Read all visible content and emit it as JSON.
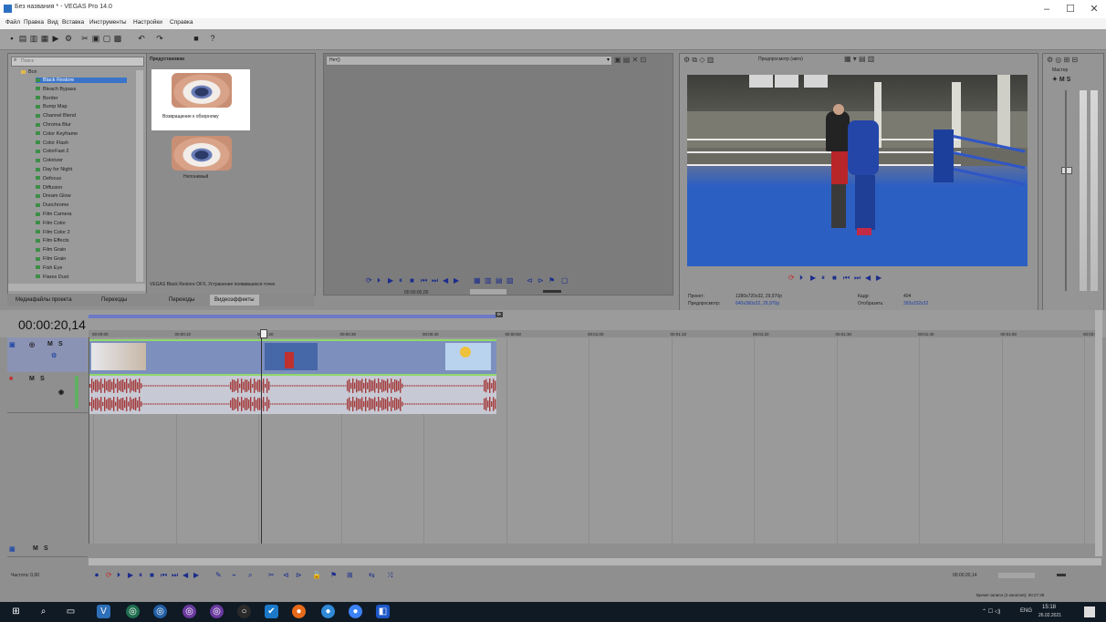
{
  "window": {
    "title": "Без названия * - VEGAS Pro 14.0",
    "controls": [
      "–",
      "☐",
      "✕"
    ]
  },
  "menu": [
    "Файл",
    "Правка",
    "Вид",
    "Вставка",
    "Инструменты",
    "Настройки",
    "Справка"
  ],
  "toolbar_icons": [
    "new-icon",
    "open-icon",
    "save-icon",
    "render-icon",
    "properties-icon",
    "cut-icon",
    "copy-icon",
    "paste-icon",
    "undo-icon",
    "redo-icon",
    "lock-icon",
    "help-icon"
  ],
  "explorer": {
    "search_placeholder": "Поиск",
    "root": "Все",
    "items": [
      "Black Restore",
      "Bleach Bypass",
      "Border",
      "Bump Map",
      "Channel Blend",
      "Chroma Blur",
      "Color Keyframe",
      "Color Flash",
      "ColorFast 2",
      "Colorizer",
      "Day for Night",
      "Defocus",
      "Diffusion",
      "Dream Glow",
      "Duochrome",
      "Film Camera",
      "Film Color",
      "Film Color 2",
      "Film Effects",
      "Film Grain",
      "Film Grain",
      "Fish Eye",
      "Flares Dust"
    ],
    "selected_index": 0
  },
  "presets": {
    "header": "Предустановки",
    "items": [
      {
        "label": "Возвращение к обзорному"
      },
      {
        "label": "Непонимый"
      }
    ],
    "status_text": "VEGAS Black Restore OFX, Устранение появившихся точек"
  },
  "left_tabs": [
    "Медиафайлы проекта",
    "Переходы",
    "Переходы",
    "Видеоэффекты"
  ],
  "trimmer": {
    "dropdown": "Нет()",
    "time": "00:00:00,00"
  },
  "preview": {
    "quality": "Предпросмотр (авто)",
    "project_label": "Проект:",
    "project_value": "1280x720x32, 29,970p",
    "preview_label": "Предпросмотр:",
    "preview_value": "640x360x32, 29,970p",
    "frame_label": "Кадр:",
    "frame_value": "404",
    "display_label": "Отобразить:",
    "display_value": "393x232x32"
  },
  "mixer": {
    "label": "Мастер",
    "buttons": [
      "M",
      "S"
    ]
  },
  "timeline": {
    "timecode": "00:00:20,14",
    "marker": "00:00:20,14",
    "ruler": [
      "00:00:00",
      "00:00:10",
      "00:00:20",
      "00:00:30",
      "00:00:40",
      "00:00:50",
      "00:01:00",
      "00:01:10",
      "00:01:20",
      "00:01:30",
      "00:01:40",
      "00:01:50",
      "00:02:00"
    ],
    "track_labels": [
      "M",
      "S"
    ],
    "rate_label": "Частота: 0,00",
    "end_time": "00:00:20,14",
    "record_status": "Время записи (2 каналов): 00:27:39"
  },
  "taskbar": {
    "time": "15:18",
    "date": "26.02.2021",
    "lang": "ENG"
  }
}
